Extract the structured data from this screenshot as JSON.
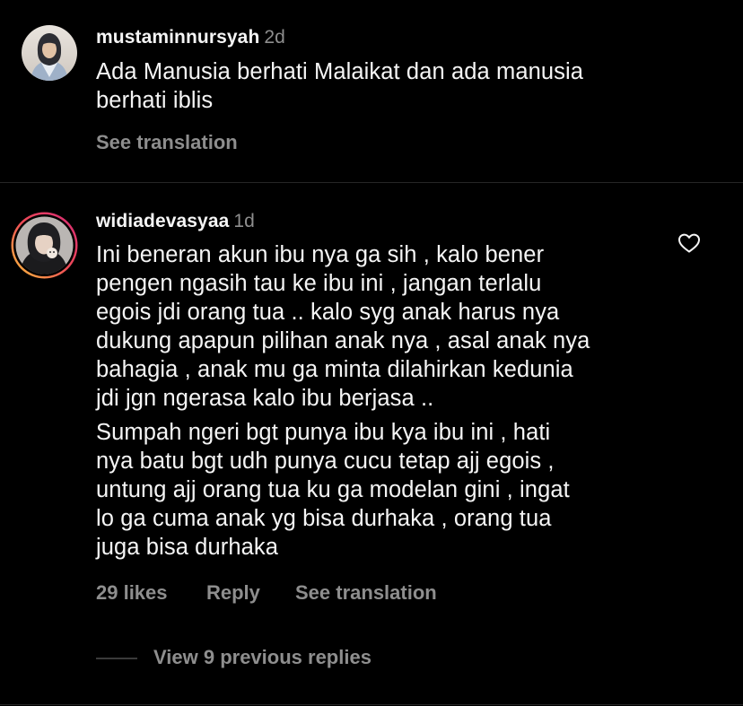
{
  "comments": [
    {
      "username": "mustaminnursyah",
      "time": "2d",
      "text_lines": [
        "Ada Manusia berhati Malaikat dan ada manusia",
        "berhati iblis"
      ],
      "see_translation": "See translation",
      "avatar_icon": "profile-photo"
    },
    {
      "username": "widiadevasyaa",
      "time": "1d",
      "paragraphs": [
        [
          "Ini beneran akun ibu nya ga sih , kalo bener",
          "pengen ngasih tau ke ibu ini , jangan terlalu",
          "egois jdi orang tua .. kalo syg anak harus nya",
          "dukung apapun pilihan anak nya , asal anak nya",
          "bahagia , anak mu ga minta dilahirkan kedunia",
          "jdi jgn ngerasa kalo ibu berjasa .."
        ],
        [
          "Sumpah ngeri bgt punya ibu kya ibu ini , hati",
          "nya batu bgt udh punya cucu tetap ajj egois ,",
          "untung ajj orang tua ku ga modelan gini , ingat",
          "lo ga cuma anak yg bisa durhaka , orang tua",
          "juga bisa durhaka"
        ]
      ],
      "likes": "29 likes",
      "reply": "Reply",
      "see_translation": "See translation",
      "view_replies": "View 9 previous replies",
      "avatar_icon": "profile-photo-story-ring",
      "like_icon": "heart-outline-icon"
    }
  ],
  "colors": {
    "background": "#000000",
    "text": "#f5f5f5",
    "secondary": "#8e8e8e",
    "divider": "#262626",
    "story_ring_start": "#f9c33b",
    "story_ring_end": "#d62976"
  }
}
